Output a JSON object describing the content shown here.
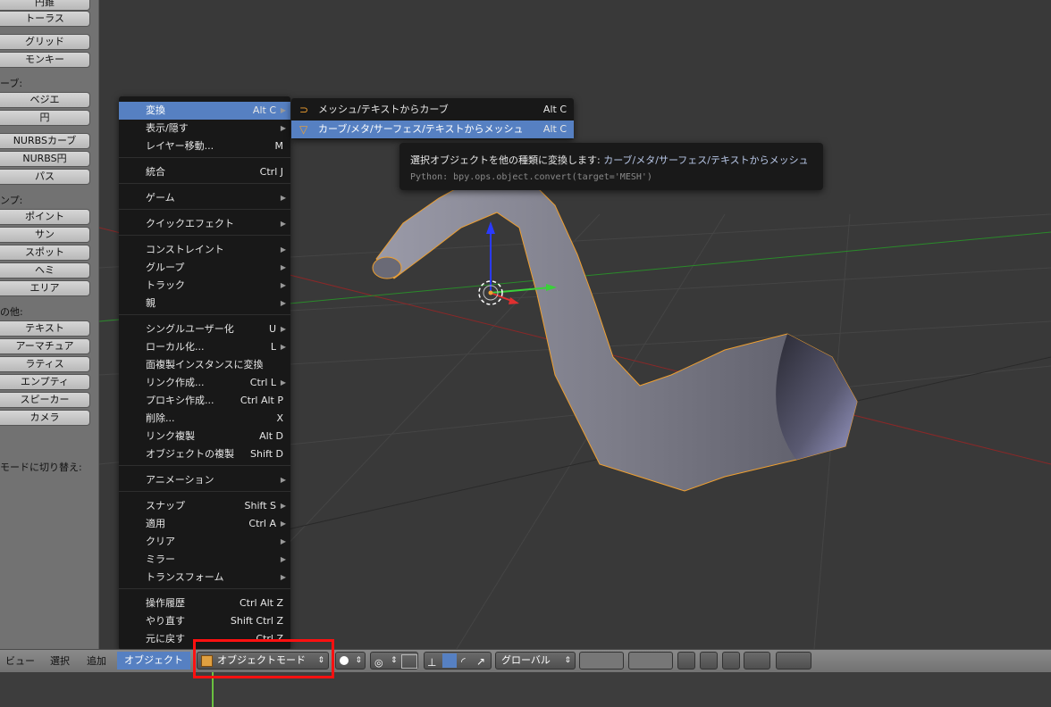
{
  "toolshelf": {
    "top_items": [
      "円錐",
      "トーラス"
    ],
    "mesh_items": [
      "グリッド",
      "モンキー"
    ],
    "curve_label": "ーブ:",
    "curve_items": [
      "ベジエ",
      "円",
      "NURBSカーブ",
      "NURBS円",
      "パス"
    ],
    "lamp_label": "ンプ:",
    "lamp_items": [
      "ポイント",
      "サン",
      "スポット",
      "ヘミ",
      "エリア"
    ],
    "other_label": "の他:",
    "other_items": [
      "テキスト",
      "アーマチュア",
      "ラティス",
      "エンプティ",
      "スピーカー",
      "カメラ"
    ],
    "mode_hint": "モードに切り替え:"
  },
  "object_menu": {
    "items": [
      {
        "label": "変換",
        "shortcut": "Alt C",
        "submenu": true,
        "highlighted": true
      },
      {
        "label": "表示/隠す",
        "shortcut": "",
        "submenu": true
      },
      {
        "label": "レイヤー移動...",
        "shortcut": "M",
        "submenu": false
      },
      {
        "label": "統合",
        "shortcut": "Ctrl J",
        "submenu": false
      },
      {
        "label": "ゲーム",
        "shortcut": "",
        "submenu": true
      },
      {
        "label": "クイックエフェクト",
        "shortcut": "",
        "submenu": true
      },
      {
        "label": "コンストレイント",
        "shortcut": "",
        "submenu": true
      },
      {
        "label": "グループ",
        "shortcut": "",
        "submenu": true
      },
      {
        "label": "トラック",
        "shortcut": "",
        "submenu": true
      },
      {
        "label": "親",
        "shortcut": "",
        "submenu": true
      },
      {
        "label": "シングルユーザー化",
        "shortcut": "U",
        "submenu": true
      },
      {
        "label": "ローカル化...",
        "shortcut": "L",
        "submenu": true
      },
      {
        "label": "面複製インスタンスに変換",
        "shortcut": "",
        "submenu": false
      },
      {
        "label": "リンク作成...",
        "shortcut": "Ctrl L",
        "submenu": true
      },
      {
        "label": "プロキシ作成...",
        "shortcut": "Ctrl Alt P",
        "submenu": false
      },
      {
        "label": "削除...",
        "shortcut": "X",
        "submenu": false
      },
      {
        "label": "リンク複製",
        "shortcut": "Alt D",
        "submenu": false
      },
      {
        "label": "オブジェクトの複製",
        "shortcut": "Shift D",
        "submenu": false
      },
      {
        "label": "アニメーション",
        "shortcut": "",
        "submenu": true
      },
      {
        "label": "スナップ",
        "shortcut": "Shift S",
        "submenu": true
      },
      {
        "label": "適用",
        "shortcut": "Ctrl A",
        "submenu": true
      },
      {
        "label": "クリア",
        "shortcut": "",
        "submenu": true
      },
      {
        "label": "ミラー",
        "shortcut": "",
        "submenu": true
      },
      {
        "label": "トランスフォーム",
        "shortcut": "",
        "submenu": true
      },
      {
        "label": "操作履歴",
        "shortcut": "Ctrl Alt Z",
        "submenu": false
      },
      {
        "label": "やり直す",
        "shortcut": "Shift Ctrl Z",
        "submenu": false
      },
      {
        "label": "元に戻す",
        "shortcut": "Ctrl Z",
        "submenu": false
      }
    ]
  },
  "convert_menu": {
    "items": [
      {
        "label": "メッシュ/テキストからカーブ",
        "shortcut": "Alt C",
        "icon": "curve-icon",
        "highlighted": false
      },
      {
        "label": "カーブ/メタ/サーフェス/テキストからメッシュ",
        "shortcut": "Alt C",
        "icon": "mesh-icon",
        "highlighted": true
      }
    ]
  },
  "tooltip": {
    "title": "選択オブジェクトを他の種類に変換します:",
    "title_value": "カーブ/メタ/サーフェス/テキストからメッシュ",
    "python": "Python: bpy.ops.object.convert(target='MESH')"
  },
  "header": {
    "menus": [
      "ビュー",
      "選択",
      "追加",
      "オブジェクト"
    ],
    "mode": "オブジェクトモード",
    "orientation": "グローバル"
  },
  "colors": {
    "highlight": "#5680c2",
    "selection_outline": "#f0a030",
    "annotation_box": "#ff1010"
  }
}
